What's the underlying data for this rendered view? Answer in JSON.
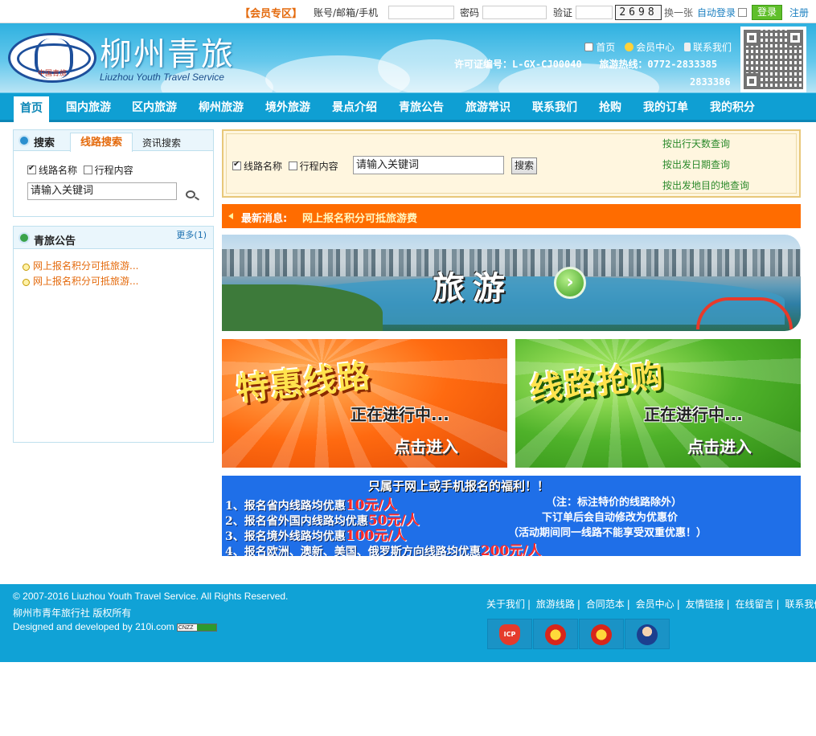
{
  "login": {
    "zone_label": "【会员专区】",
    "account_label": "账号/邮箱/手机",
    "password_label": "密码",
    "captcha_label": "验证",
    "captcha_code": "2698",
    "refresh": "换一张",
    "auto_login": "自动登录",
    "login_button": "登录",
    "register": "注册"
  },
  "header": {
    "logo_cn": "柳州青旅",
    "logo_en": "Liuzhou Youth Travel Service",
    "logo_tag": "中国青旅",
    "links": [
      "首页",
      "会员中心",
      "联系我们"
    ],
    "license": "许可证编号：L-GX-CJ00040",
    "hotline": "旅游热线：0772-2833385",
    "hotline2": "2833386"
  },
  "nav": {
    "items": [
      "首页",
      "国内旅游",
      "区内旅游",
      "柳州旅游",
      "境外旅游",
      "景点介绍",
      "青旅公告",
      "旅游常识",
      "联系我们",
      "抢购",
      "我的订单",
      "我的积分"
    ],
    "active": "首页"
  },
  "sidebar": {
    "search": {
      "title": "搜索",
      "tab_active": "线路搜索",
      "tab_other": "资讯搜索",
      "opt_name": "线路名称",
      "opt_content": "行程内容",
      "keyword": "请输入关键词"
    },
    "notice": {
      "title": "青旅公告",
      "more": "更多(1)",
      "items": [
        "网上报名积分可抵旅游...",
        "网上报名积分可抵旅游..."
      ]
    }
  },
  "main_search": {
    "opt_name": "线路名称",
    "opt_content": "行程内容",
    "keyword": "请输入关键词",
    "button": "搜索",
    "quick_links": [
      "按出行天数查询",
      "按出发日期查询",
      "按出发地目的地查询"
    ]
  },
  "news": {
    "label": "最新消息:",
    "message": "网上报名积分可抵旅游费"
  },
  "banner": {
    "title": "旅游",
    "go": "›"
  },
  "promos": [
    {
      "title": "特惠线路",
      "status": "正在进行中...",
      "action": "点击进入"
    },
    {
      "title": "线路抢购",
      "status": "正在进行中...",
      "action": "点击进入"
    }
  ],
  "offer": {
    "title": "只属于网上或手机报名的福利！！",
    "note1": "（注：标注特价的线路除外）",
    "note2": "下订单后会自动修改为优惠价",
    "note3": "（活动期间同一线路不能享受双重优惠！）",
    "lines": [
      {
        "text": "1、报名省内线路均优惠",
        "amount": "10元/人"
      },
      {
        "text": "2、报名省外国内线路均优惠",
        "amount": "50元/人"
      },
      {
        "text": "3、报名境外线路均优惠",
        "amount": "100元/人"
      },
      {
        "text": "4、报名欧洲、澳新、美国、俄罗斯方向线路均优惠",
        "amount": "200元/人"
      }
    ]
  },
  "footer": {
    "copyright": "© 2007-2016 Liuzhou Youth Travel Service. All Rights Reserved.",
    "owner": "柳州市青年旅行社 版权所有",
    "developer": "Designed and developed by 210i.com",
    "badge": "CNZZ",
    "links": [
      "关于我们",
      "旅游线路",
      "合同范本",
      "会员中心",
      "友情链接",
      "在线留言",
      "联系我们"
    ],
    "icp_label": "ICP"
  },
  "colors": {
    "brand_blue": "#0f9fd3",
    "accent_orange": "#ff6c00",
    "link_green": "#2b8a2b"
  }
}
